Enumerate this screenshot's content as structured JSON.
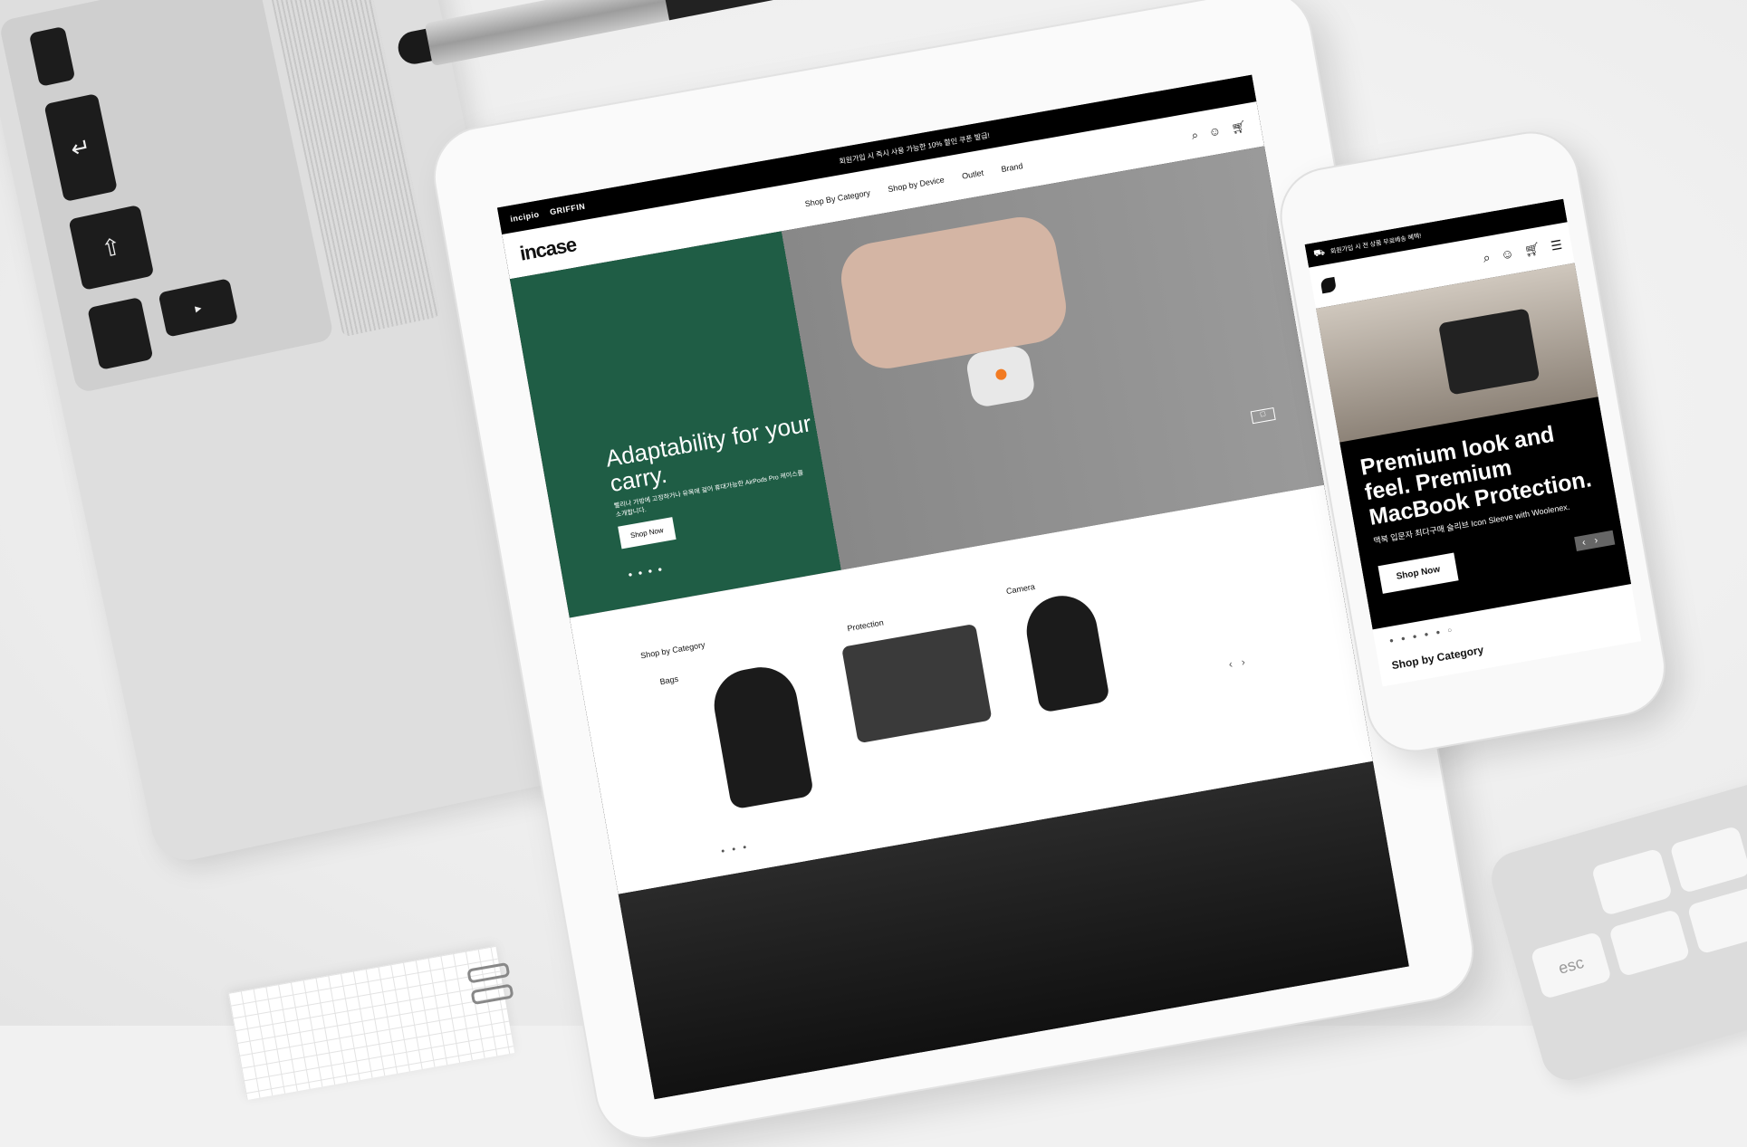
{
  "tablet": {
    "brands": [
      "incipio",
      "GRIFFIN"
    ],
    "promo": "회원가입 시 즉시 사용 가능한 10% 할인 쿠폰 발급!",
    "logo": "incase",
    "nav": [
      "Shop By Category",
      "Shop by Device",
      "Outlet",
      "Brand"
    ],
    "hero": {
      "title": "Adaptability for your carry.",
      "subtitle": "빨리나 가방에 고정하거나 유목에 걸어 휴대가능한 AirPods Pro 케이스를 소개합니다.",
      "button": "Shop Now"
    },
    "category": {
      "heading": "Shop by Category",
      "items": [
        "Bags",
        "Protection",
        "Camera"
      ]
    }
  },
  "phone": {
    "promo": "회원가입 시 전 상품 무료배송 혜택!",
    "hero": {
      "title": "Premium look and feel. Premium MacBook Protection.",
      "subtitle": "맥북 입문자 최다구매 슬리브 Icon Sleeve with Woolenex.",
      "button": "Shop Now"
    },
    "category_heading": "Shop by Category"
  },
  "keyboard": {
    "esc_key": "esc"
  }
}
